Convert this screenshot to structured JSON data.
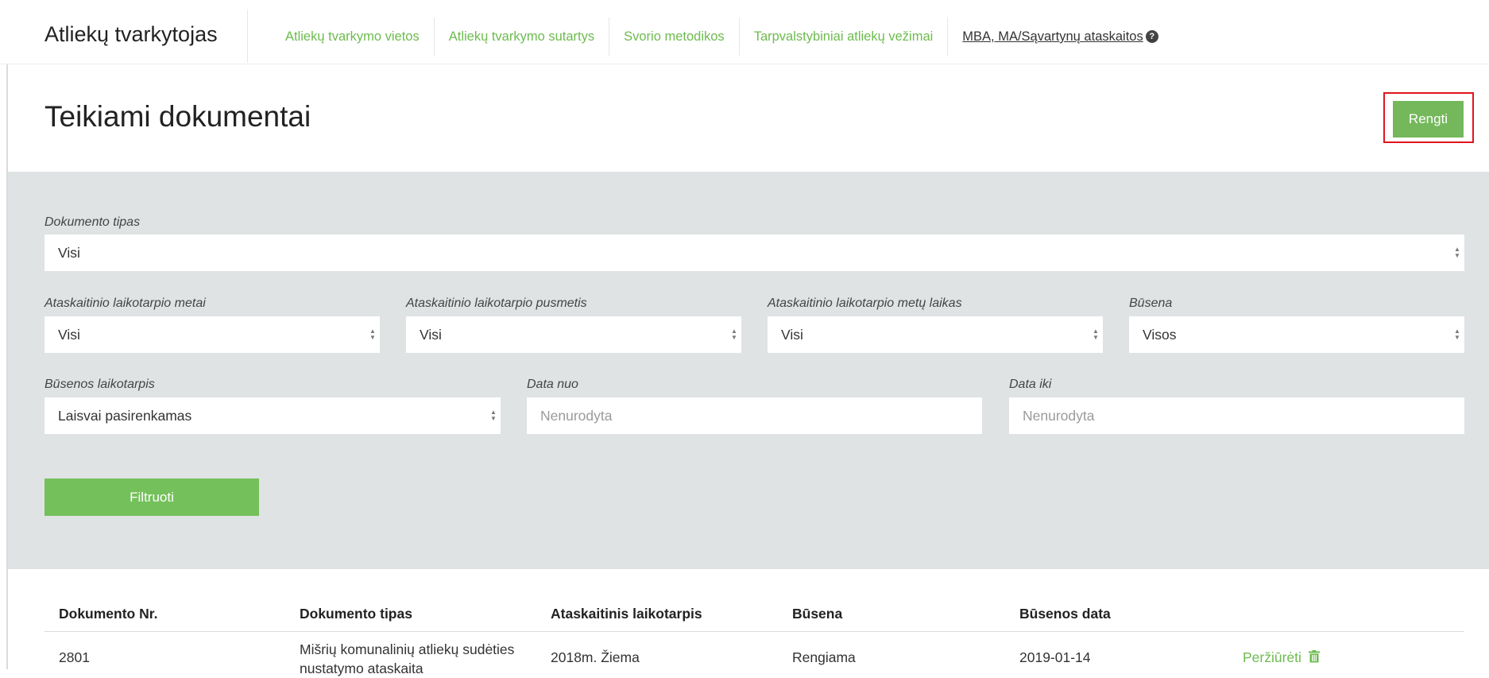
{
  "header": {
    "brand": "Atliekų tvarkytojas",
    "nav": [
      "Atliekų tvarkymo vietos",
      "Atliekų tvarkymo sutartys",
      "Svorio metodikos",
      "Tarpvalstybiniai atliekų vežimai",
      "MBA, MA/Sąvartynų ataskaitos"
    ],
    "help_icon": "?"
  },
  "page": {
    "title": "Teikiami dokumentai",
    "create_button": "Rengti"
  },
  "filters": {
    "document_type": {
      "label": "Dokumento tipas",
      "value": "Visi"
    },
    "period_year": {
      "label": "Ataskaitinio laikotarpio metai",
      "value": "Visi"
    },
    "period_half": {
      "label": "Ataskaitinio laikotarpio pusmetis",
      "value": "Visi"
    },
    "period_season": {
      "label": "Ataskaitinio laikotarpio metų laikas",
      "value": "Visi"
    },
    "status": {
      "label": "Būsena",
      "value": "Visos"
    },
    "status_period": {
      "label": "Būsenos laikotarpis",
      "value": "Laisvai pasirenkamas"
    },
    "date_from": {
      "label": "Data nuo",
      "placeholder": "Nenurodyta"
    },
    "date_to": {
      "label": "Data iki",
      "placeholder": "Nenurodyta"
    },
    "submit": "Filtruoti"
  },
  "table": {
    "columns": [
      "Dokumento Nr.",
      "Dokumento tipas",
      "Ataskaitinis laikotarpis",
      "Būsena",
      "Būsenos data"
    ],
    "rows": [
      {
        "number": "2801",
        "type": "Mišrių komunalinių atliekų sudėties nustatymo ataskaita",
        "period": "2018m. Žiema",
        "status": "Rengiama",
        "status_date": "2019-01-14",
        "action": "Peržiūrėti"
      }
    ]
  },
  "colors": {
    "accent": "#74b85b",
    "link": "#6dbb4e",
    "panel": "#dfe3e3",
    "highlight": "#e0141c"
  }
}
